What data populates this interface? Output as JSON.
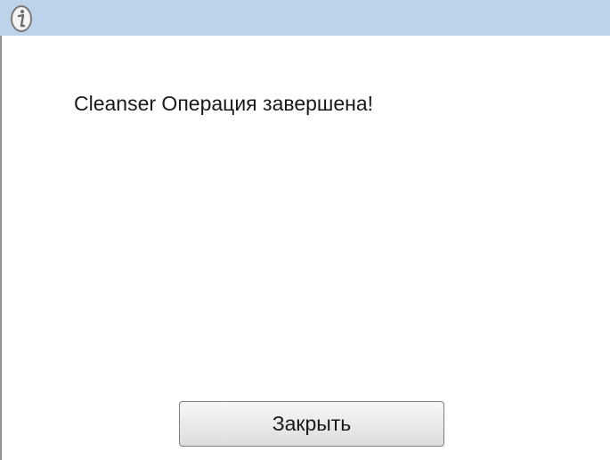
{
  "dialog": {
    "icon": "info-icon",
    "message": "Cleanser Операция завершена!",
    "close_button_label": "Закрыть"
  },
  "colors": {
    "titlebar": "#bdd3ea",
    "background": "#ffffff",
    "border": "#8f9196",
    "text": "#1a1a1a"
  }
}
